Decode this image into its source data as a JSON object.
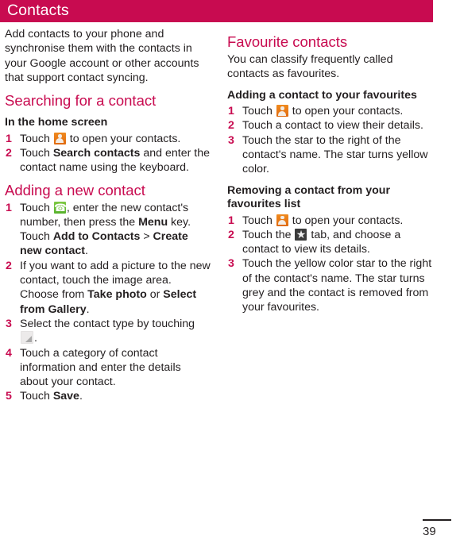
{
  "header": {
    "title": "Contacts",
    "bar_color": "#c80b50"
  },
  "colors": {
    "accent": "#c80b50",
    "text": "#231f20",
    "contacts_icon": "#e8791a",
    "phone_icon": "#5fb933",
    "star_icon_bg": "#3b3b3b",
    "dropdown_icon": "#a9a9a9"
  },
  "left_column": {
    "intro": "Add contacts to your phone and synchronise them with the contacts in your Google account or other accounts that support contact syncing.",
    "section_search": {
      "heading": "Searching for a contact",
      "subheading": "In the home screen",
      "steps": [
        {
          "num": "1",
          "parts": [
            {
              "type": "text",
              "text": "Touch "
            },
            {
              "type": "icon",
              "icon": "contacts-icon"
            },
            {
              "type": "text",
              "text": " to open your contacts."
            }
          ]
        },
        {
          "num": "2",
          "parts": [
            {
              "type": "text",
              "text": "Touch "
            },
            {
              "type": "bold",
              "text": "Search contacts"
            },
            {
              "type": "text",
              "text": " and enter the contact name using the keyboard."
            }
          ]
        }
      ]
    },
    "section_add": {
      "heading": "Adding a new contact",
      "steps": [
        {
          "num": "1",
          "parts": [
            {
              "type": "text",
              "text": "Touch "
            },
            {
              "type": "icon",
              "icon": "phone-icon"
            },
            {
              "type": "text",
              "text": ", enter the new contact's number, then press the "
            },
            {
              "type": "bold",
              "text": "Menu"
            },
            {
              "type": "text",
              "text": " key. Touch "
            },
            {
              "type": "bold",
              "text": "Add to Contacts"
            },
            {
              "type": "text",
              "text": " > "
            },
            {
              "type": "bold",
              "text": "Create new contact"
            },
            {
              "type": "text",
              "text": "."
            }
          ]
        },
        {
          "num": "2",
          "parts": [
            {
              "type": "text",
              "text": "If you want to add a picture to the new contact, touch the image area. Choose from "
            },
            {
              "type": "bold",
              "text": "Take photo"
            },
            {
              "type": "text",
              "text": " or "
            },
            {
              "type": "bold",
              "text": "Select from Gallery"
            },
            {
              "type": "text",
              "text": "."
            }
          ]
        },
        {
          "num": "3",
          "parts": [
            {
              "type": "text",
              "text": "Select the contact type by touching "
            },
            {
              "type": "icon",
              "icon": "dropdown-icon"
            },
            {
              "type": "text",
              "text": "."
            }
          ]
        },
        {
          "num": "4",
          "parts": [
            {
              "type": "text",
              "text": "Touch a category of contact information and enter the details about your contact."
            }
          ]
        },
        {
          "num": "5",
          "parts": [
            {
              "type": "text",
              "text": "Touch "
            },
            {
              "type": "bold",
              "text": "Save"
            },
            {
              "type": "text",
              "text": "."
            }
          ]
        }
      ]
    }
  },
  "right_column": {
    "section_favourite": {
      "heading": "Favourite contacts",
      "intro": "You can classify frequently called contacts as favourites.",
      "subheading_add": "Adding a contact to your favourites",
      "steps_add": [
        {
          "num": "1",
          "parts": [
            {
              "type": "text",
              "text": "Touch "
            },
            {
              "type": "icon",
              "icon": "contacts-icon"
            },
            {
              "type": "text",
              "text": " to open your contacts."
            }
          ]
        },
        {
          "num": "2",
          "parts": [
            {
              "type": "text",
              "text": "Touch a contact to view their details."
            }
          ]
        },
        {
          "num": "3",
          "parts": [
            {
              "type": "text",
              "text": "Touch the star to the right of the contact's name. The star turns yellow color."
            }
          ]
        }
      ],
      "subheading_remove": "Removing a contact from your favourites list",
      "steps_remove": [
        {
          "num": "1",
          "parts": [
            {
              "type": "text",
              "text": "Touch "
            },
            {
              "type": "icon",
              "icon": "contacts-icon"
            },
            {
              "type": "text",
              "text": " to open your contacts."
            }
          ]
        },
        {
          "num": "2",
          "parts": [
            {
              "type": "text",
              "text": "Touch the "
            },
            {
              "type": "icon",
              "icon": "star-icon"
            },
            {
              "type": "text",
              "text": " tab, and choose a contact to view its details."
            }
          ]
        },
        {
          "num": "3",
          "parts": [
            {
              "type": "text",
              "text": "Touch the yellow color star to the right of the contact's name. The star turns grey and the contact is removed from your favourites."
            }
          ]
        }
      ]
    }
  },
  "footer": {
    "page_number": "39"
  }
}
